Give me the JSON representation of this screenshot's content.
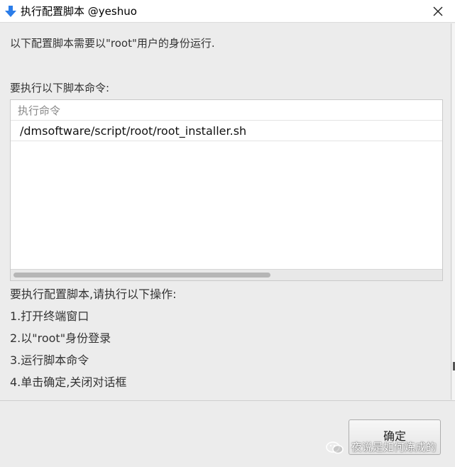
{
  "window": {
    "title": "执行配置脚本 @yeshuo"
  },
  "content": {
    "intro": "以下配置脚本需要以\"root\"用户的身份运行.",
    "command_label": "要执行以下脚本命令:",
    "table": {
      "column_header": "执行命令",
      "rows": [
        "/dmsoftware/script/root/root_installer.sh"
      ],
      "scroll_position": 0.0
    },
    "steps_title": "要执行配置脚本,请执行以下操作:",
    "steps": [
      "1.打开终端窗口",
      "2.以\"root\"身份登录",
      "3.运行脚本命令",
      "4.单击确定,关闭对话框"
    ]
  },
  "footer": {
    "ok_label": "确定",
    "watermark": "夜说是如何炼成的"
  },
  "colors": {
    "title_icon": "#2b7de9",
    "background": "#ececec"
  },
  "icons": {
    "title": "down-arrow-icon",
    "close": "close-icon",
    "watermark": "wechat-icon"
  }
}
